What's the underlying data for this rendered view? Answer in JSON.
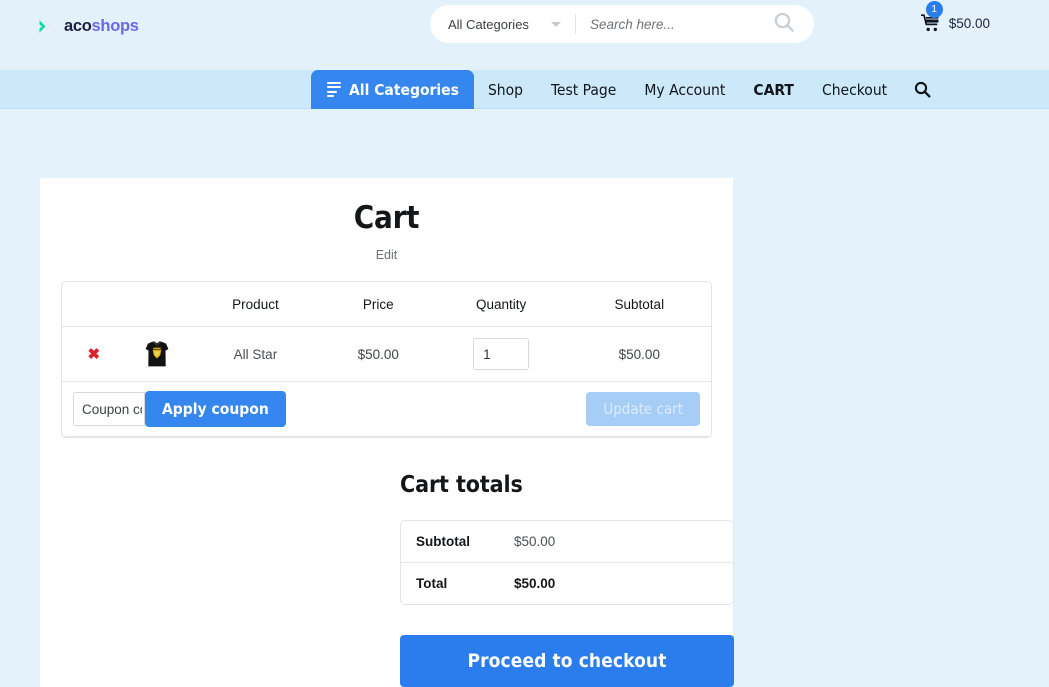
{
  "header": {
    "logo": {
      "mark_icon": "logo-chevron-icon",
      "text_primary": "aco",
      "text_secondary": "shops",
      "mark_color_1": "#0ed6a4",
      "mark_color_2": "#e8eaf4"
    },
    "search": {
      "category_label": "All Categories",
      "category_options": [
        "All Categories"
      ],
      "chevron_icon": "chevron-down-icon",
      "placeholder": "Search here...",
      "value": "",
      "submit_icon": "search-icon"
    },
    "cart_mini": {
      "icon": "shopping-cart-icon",
      "badge_count": "1",
      "total": "$50.00",
      "badge_color": "#2b7ced"
    },
    "bg_color": "#e3f2fa"
  },
  "nav": {
    "bg_color": "#cde8f8",
    "all_categories": {
      "label": "All Categories",
      "icon": "list-menu-icon",
      "bg_color": "#3586ee"
    },
    "items": [
      {
        "label": "Shop",
        "active": false
      },
      {
        "label": "Test Page",
        "active": false
      },
      {
        "label": "My Account",
        "active": false
      },
      {
        "label": "CART",
        "active": true
      },
      {
        "label": "Checkout",
        "active": false
      }
    ],
    "search_icon": "search-icon"
  },
  "cart": {
    "title": "Cart",
    "edit_label": "Edit",
    "columns": [
      "",
      "",
      "Product",
      "Price",
      "Quantity",
      "Subtotal"
    ],
    "headers": {
      "product": "Product",
      "price": "Price",
      "quantity": "Quantity",
      "subtotal": "Subtotal"
    },
    "items": [
      {
        "remove_icon": "remove-cross-icon",
        "remove_glyph": "✖",
        "thumbnail_icon": "tshirt-thumbnail-icon",
        "thumbnail_alt": "All Star",
        "product": "All Star",
        "price": "$50.00",
        "quantity": "1",
        "subtotal": "$50.00"
      }
    ],
    "coupon": {
      "placeholder": "Coupon code",
      "value": "",
      "apply_label": "Apply coupon",
      "update_label": "Update cart",
      "update_disabled": true
    },
    "totals": {
      "title": "Cart totals",
      "rows": [
        {
          "label": "Subtotal",
          "value": "$50.00"
        },
        {
          "label": "Total",
          "value": "$50.00"
        }
      ]
    },
    "checkout_label": "Proceed to checkout",
    "accent_color": "#2b7ced"
  }
}
